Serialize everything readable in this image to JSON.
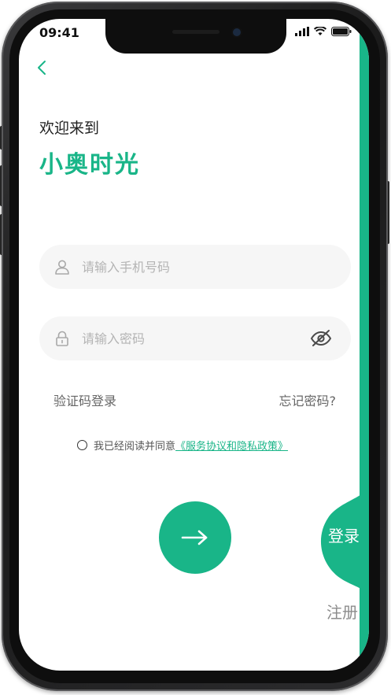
{
  "status": {
    "time": "09:41"
  },
  "header": {
    "welcome": "欢迎来到",
    "app_name": "小奥时光"
  },
  "form": {
    "phone_placeholder": "请输入手机号码",
    "password_placeholder": "请输入密码",
    "sms_login_label": "验证码登录",
    "forgot_password_label": "忘记密码?",
    "agree_text": "我已经阅读并同意",
    "policy_link_text": "《服务协议和隐私政策》"
  },
  "tabs": {
    "login_label": "登录",
    "register_label": "注册"
  },
  "colors": {
    "accent": "#19b588",
    "placeholder": "#b4b4b4",
    "field_bg": "#f6f6f6"
  },
  "icons": {
    "back": "chevron-left-icon",
    "user": "user-icon",
    "lock": "lock-icon",
    "eye": "eye-off-icon",
    "submit": "arrow-right-icon"
  }
}
